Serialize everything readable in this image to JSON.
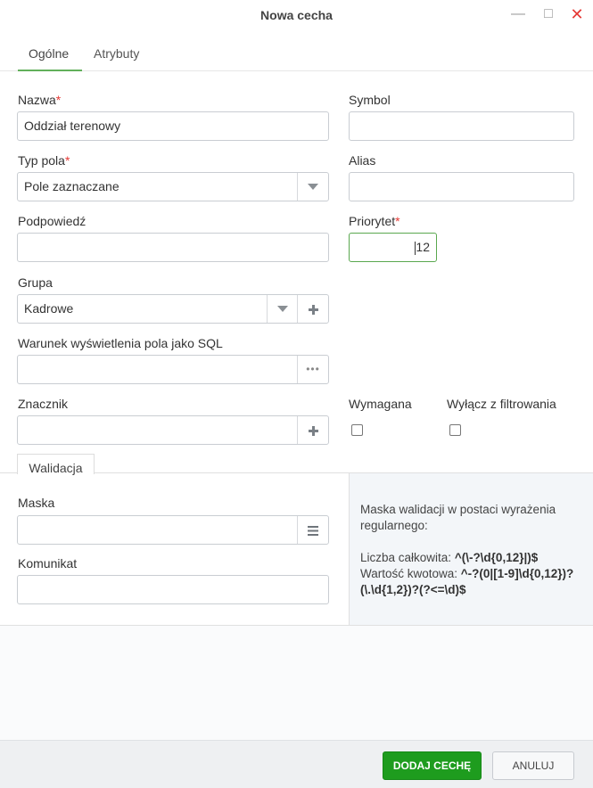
{
  "window": {
    "title": "Nowa cecha"
  },
  "tabs": [
    {
      "label": "Ogólne",
      "active": true
    },
    {
      "label": "Atrybuty",
      "active": false
    }
  ],
  "form": {
    "name": {
      "label": "Nazwa",
      "required_mark": "*",
      "value": "Oddział terenowy"
    },
    "symbol": {
      "label": "Symbol",
      "value": ""
    },
    "field_type": {
      "label": "Typ pola",
      "required_mark": "*",
      "value": "Pole zaznaczane"
    },
    "alias": {
      "label": "Alias",
      "value": ""
    },
    "hint": {
      "label": "Podpowiedź",
      "value": ""
    },
    "priority": {
      "label": "Priorytet",
      "required_mark": "*",
      "value": "12"
    },
    "group": {
      "label": "Grupa",
      "value": "Kadrowe"
    },
    "sql_condition": {
      "label": "Warunek wyświetlenia pola jako SQL",
      "value": ""
    },
    "tag": {
      "label": "Znacznik",
      "value": ""
    },
    "required_check": {
      "label": "Wymagana",
      "checked": false
    },
    "exclude_filter": {
      "label": "Wyłącz z filtrowania",
      "checked": false
    }
  },
  "validation": {
    "tab_label": "Walidacja",
    "mask": {
      "label": "Maska",
      "value": ""
    },
    "message": {
      "label": "Komunikat",
      "value": ""
    },
    "help": {
      "intro": "Maska walidacji w postaci wyrażenia regularnego:",
      "integer_label": "Liczba całkowita: ",
      "integer_regex": "^(\\-?\\d{0,12}|)$",
      "amount_label": "Wartość kwotowa: ",
      "amount_regex": "^-?(0|[1-9]\\d{0,12})?(\\.\\d{1,2})?(?<=\\d)$"
    }
  },
  "footer": {
    "add_label": "DODAJ CECHĘ",
    "cancel_label": "ANULUJ"
  },
  "colors": {
    "accent": "#62b05b",
    "required": "#e53935",
    "primary_button": "#1e9c1e"
  }
}
